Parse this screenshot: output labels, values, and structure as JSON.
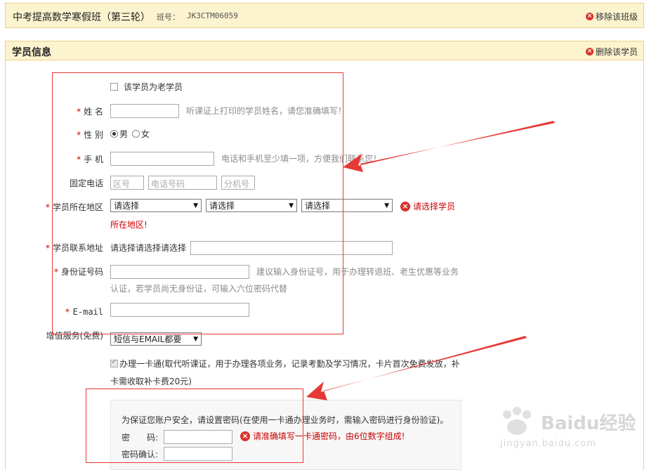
{
  "class_bar": {
    "title": "中考提高数学寒假班（第三轮）",
    "class_no_label": "班号：",
    "class_no": "JK3CTM06059",
    "remove_class": "移除该班级"
  },
  "panel": {
    "title": "学员信息",
    "delete_student": "删除该学员"
  },
  "form": {
    "old_student": "该学员为老学员",
    "name_label": "姓 名",
    "name_hint": "听课证上打印的学员姓名，请您准确填写！",
    "gender_label": "性 别",
    "gender_male": "男",
    "gender_female": "女",
    "mobile_label": "手 机",
    "mobile_hint": "电话和手机至少填一项，方便我们联系您！",
    "phone_label": "固定电话",
    "phone_area_placeholder": "区号",
    "phone_number_placeholder": "电话号码",
    "phone_ext_placeholder": "分机号",
    "region_label": "学员所在地区",
    "region_select_1": "请选择",
    "region_select_2": "请选择",
    "region_select_3": "请选择",
    "region_error_1": "请选择学员",
    "region_error_2": "所在地区!",
    "address_label": "学员联系地址",
    "address_prefix": "请选择请选择请选择",
    "id_label": "身份证号码",
    "id_hint_1": "建议输入身份证号，用于办理转退班、老生优惠等业务",
    "id_hint_2": "认证，若学员尚无身份证，可输入六位密码代替",
    "email_label": "E-mail",
    "service_label": "增值服务(免费)",
    "service_select": "短信与EMAIL都要",
    "card_text_1": "办理一卡通(取代听课证，用于办理各项业务，记录考勤及学习情况，卡片首次免费发放，补",
    "card_text_2": "卡需收取补卡费20元)",
    "pwd_intro": "为保证您账户安全，请设置密码(在使用一卡通办理业务时，需输入密码进行身份验证)。",
    "pwd_label": "密　　码:",
    "pwd_error": "请准确填写一卡通密码，由6位数字组成!",
    "pwd_confirm_label": "密码确认:"
  },
  "watermark": {
    "brand": "Baidu经验",
    "url": "jingyan.baidu.com"
  },
  "colors": {
    "header_bg": "#fcf3cf",
    "header_border": "#e8d08a",
    "required": "#cc0000",
    "annotation": "#e53935"
  }
}
